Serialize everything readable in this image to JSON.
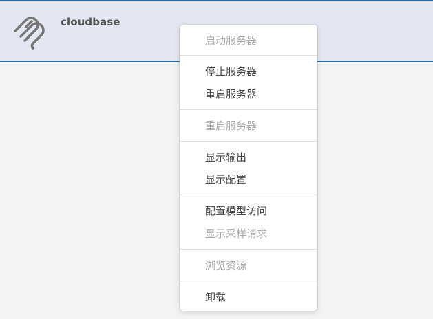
{
  "server": {
    "name": "cloudbase",
    "logo_icon": "modelcontextprotocol-logo-icon"
  },
  "menu": {
    "items": [
      {
        "label": "启动服务器",
        "enabled": false
      },
      {
        "label": "停止服务器",
        "enabled": true
      },
      {
        "label": "重启服务器",
        "enabled": true
      },
      {
        "label": "重启服务器",
        "enabled": false
      },
      {
        "label": "显示输出",
        "enabled": true
      },
      {
        "label": "显示配置",
        "enabled": true
      },
      {
        "label": "配置模型访问",
        "enabled": true
      },
      {
        "label": "显示采样请求",
        "enabled": false
      },
      {
        "label": "浏览资源",
        "enabled": false
      },
      {
        "label": "卸载",
        "enabled": true
      }
    ]
  },
  "colors": {
    "header_background": "#e4e6f1",
    "selection_border": "#0078d4",
    "page_background": "#f3f3f3",
    "enabled_text": "#444444",
    "disabled_text": "#a9a9a9"
  }
}
